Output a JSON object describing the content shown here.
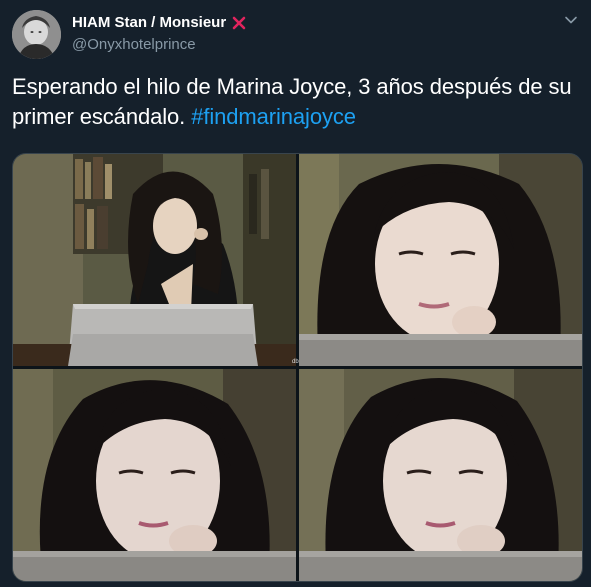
{
  "tweet": {
    "display_name": "HIAM Stan / Monsieur",
    "handle": "@Onyxhotelprince",
    "text_main": "Esperando el hilo de Marina Joyce, 3 años después de su primer escándalo. ",
    "hashtag": "#findmarinajoyce",
    "watermark": "db"
  },
  "icons": {
    "badge": "red-x-icon",
    "menu": "chevron-down-icon"
  },
  "colors": {
    "background": "#15202b",
    "text": "#ffffff",
    "secondary_text": "#8899a6",
    "link": "#1da1f2",
    "badge_red": "#e0245e",
    "border": "#38444d"
  }
}
